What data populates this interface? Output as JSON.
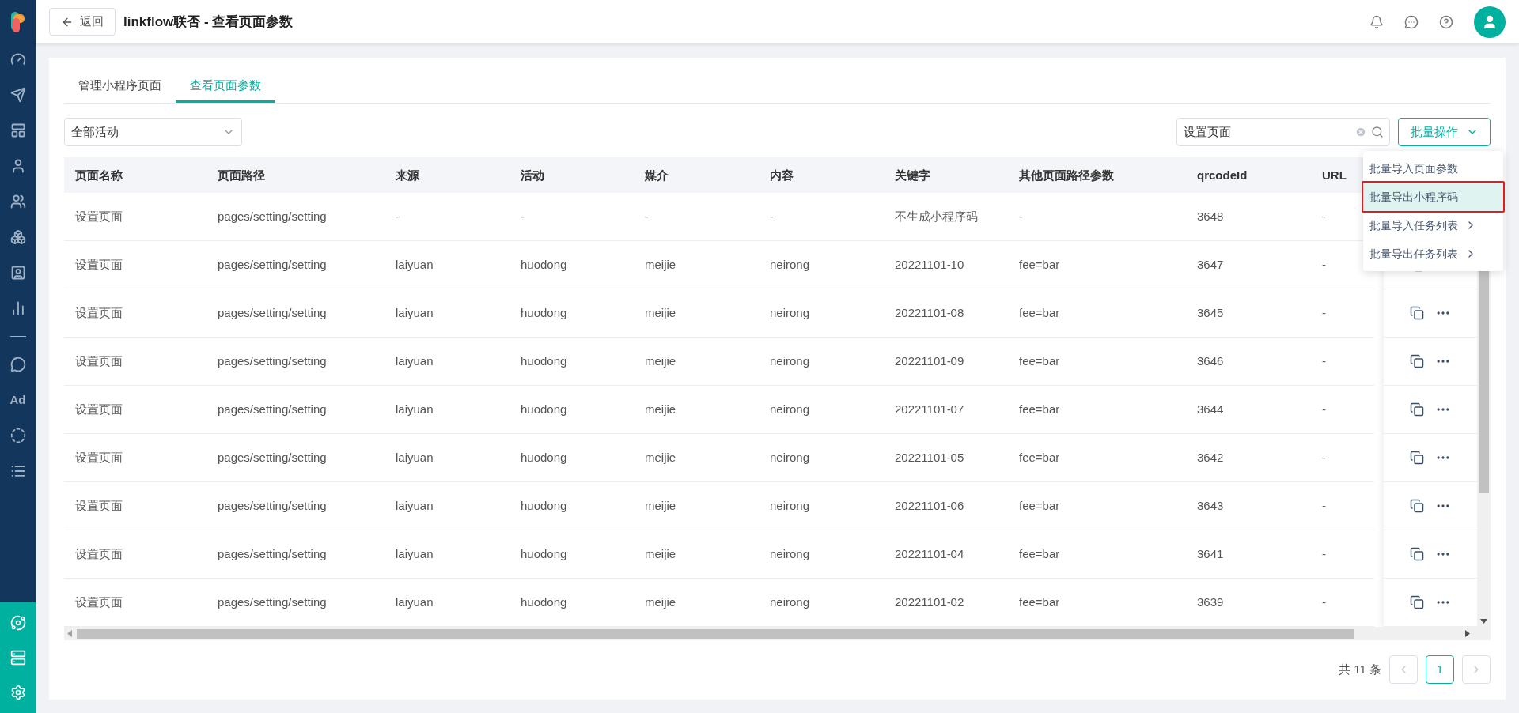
{
  "header": {
    "back_button": "返回",
    "title": "linkflow联否 - 查看页面参数"
  },
  "sidebar": {
    "ad_label": "Ad"
  },
  "tabs": [
    {
      "label": "管理小程序页面",
      "selected": false
    },
    {
      "label": "查看页面参数",
      "selected": true
    }
  ],
  "filter": {
    "value": "全部活动"
  },
  "search": {
    "value": "设置页面"
  },
  "batch_button": "批量操作",
  "batch_menu": [
    {
      "label": "批量导入页面参数",
      "selected": false,
      "has_submenu": false
    },
    {
      "label": "批量导出小程序码",
      "selected": true,
      "has_submenu": false
    },
    {
      "label": "批量导入任务列表",
      "selected": false,
      "has_submenu": true
    },
    {
      "label": "批量导出任务列表",
      "selected": false,
      "has_submenu": true
    }
  ],
  "table": {
    "columns": [
      "页面名称",
      "页面路径",
      "来源",
      "活动",
      "媒介",
      "内容",
      "关键字",
      "其他页面路径参数",
      "qrcodeId",
      "URL"
    ],
    "rows": [
      [
        "设置页面",
        "pages/setting/setting",
        "-",
        "-",
        "-",
        "-",
        "不生成小程序码",
        "-",
        "3648",
        "-"
      ],
      [
        "设置页面",
        "pages/setting/setting",
        "laiyuan",
        "huodong",
        "meijie",
        "neirong",
        "20221101-10",
        "fee=bar",
        "3647",
        "-"
      ],
      [
        "设置页面",
        "pages/setting/setting",
        "laiyuan",
        "huodong",
        "meijie",
        "neirong",
        "20221101-08",
        "fee=bar",
        "3645",
        "-"
      ],
      [
        "设置页面",
        "pages/setting/setting",
        "laiyuan",
        "huodong",
        "meijie",
        "neirong",
        "20221101-09",
        "fee=bar",
        "3646",
        "-"
      ],
      [
        "设置页面",
        "pages/setting/setting",
        "laiyuan",
        "huodong",
        "meijie",
        "neirong",
        "20221101-07",
        "fee=bar",
        "3644",
        "-"
      ],
      [
        "设置页面",
        "pages/setting/setting",
        "laiyuan",
        "huodong",
        "meijie",
        "neirong",
        "20221101-05",
        "fee=bar",
        "3642",
        "-"
      ],
      [
        "设置页面",
        "pages/setting/setting",
        "laiyuan",
        "huodong",
        "meijie",
        "neirong",
        "20221101-06",
        "fee=bar",
        "3643",
        "-"
      ],
      [
        "设置页面",
        "pages/setting/setting",
        "laiyuan",
        "huodong",
        "meijie",
        "neirong",
        "20221101-04",
        "fee=bar",
        "3641",
        "-"
      ],
      [
        "设置页面",
        "pages/setting/setting",
        "laiyuan",
        "huodong",
        "meijie",
        "neirong",
        "20221101-02",
        "fee=bar",
        "3639",
        "-"
      ]
    ]
  },
  "pagination": {
    "total": "共 11 条",
    "prev_disabled": true,
    "next_disabled": true,
    "pages": [
      {
        "label": "1",
        "selected": true
      }
    ]
  }
}
